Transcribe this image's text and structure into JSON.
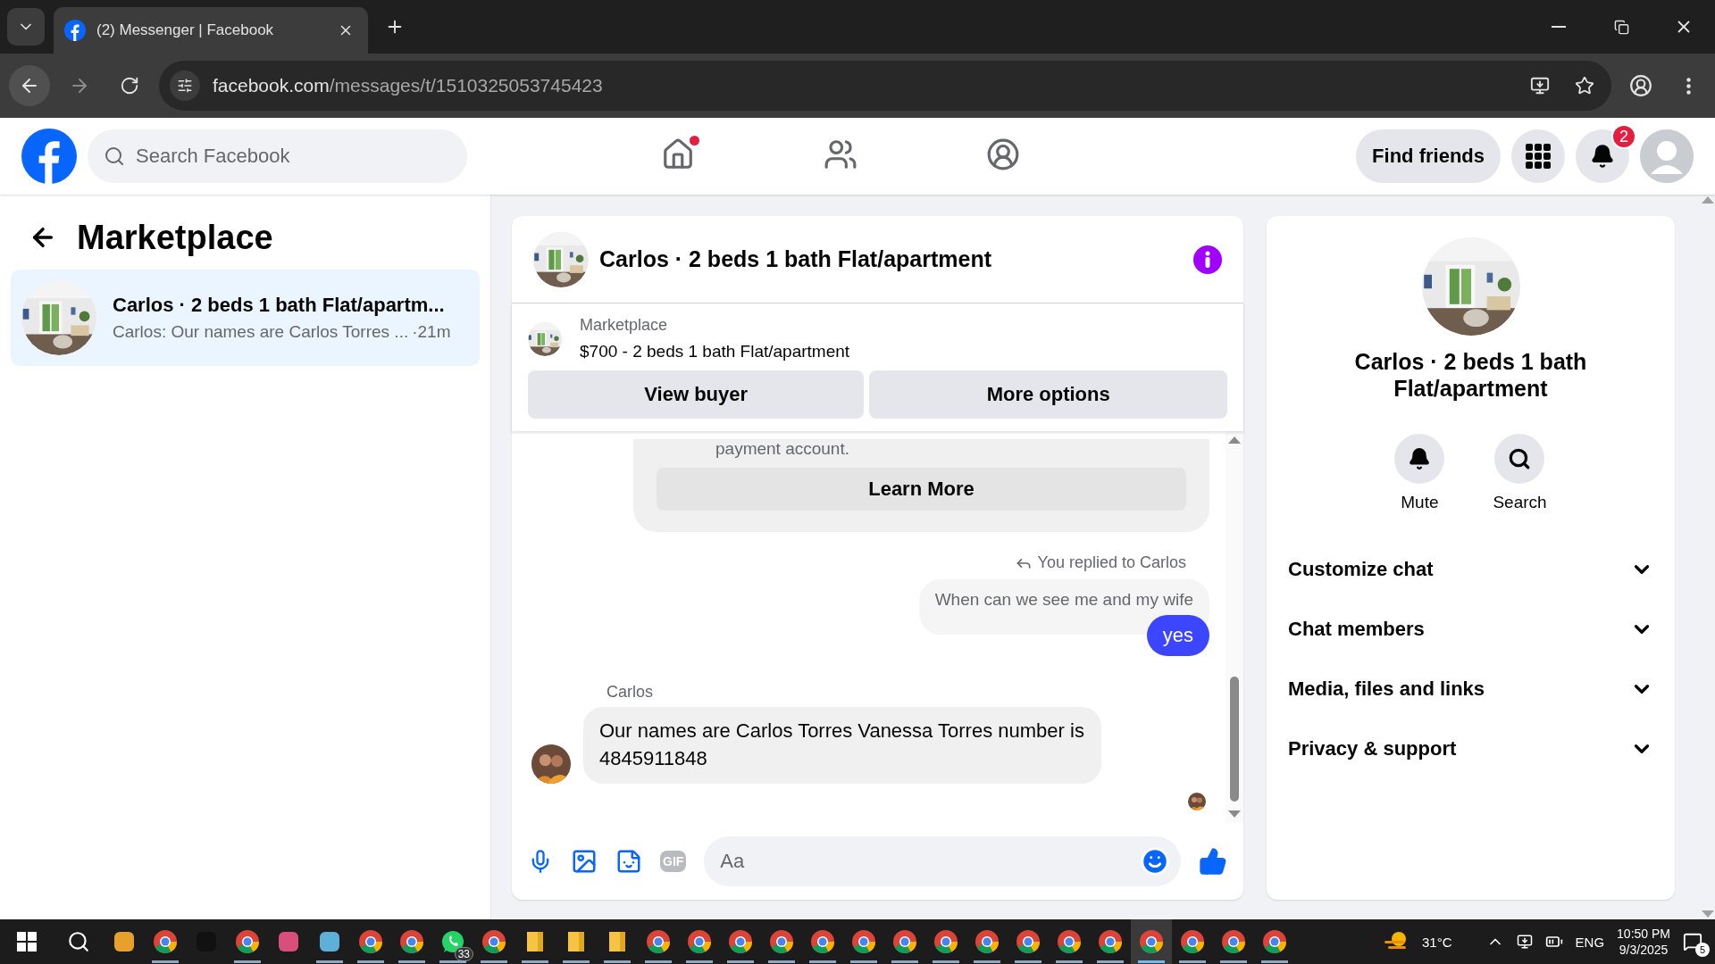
{
  "browser": {
    "tab_title": "(2) Messenger | Facebook",
    "url_host": "facebook.com",
    "url_path": "/messages/t/1510325053745423"
  },
  "header": {
    "search_placeholder": "Search Facebook",
    "nav": [
      {
        "kind": "home",
        "selected": false,
        "dot": true
      },
      {
        "kind": "friends",
        "selected": false,
        "dot": false
      },
      {
        "kind": "groups",
        "selected": false,
        "dot": false
      }
    ],
    "find_friends": "Find friends",
    "notification_count": "2"
  },
  "sidebar": {
    "title": "Marketplace",
    "conversations": [
      {
        "title": "Carlos · 2 beds 1 bath Flat/apartm...",
        "preview": "Carlos: Our names are Carlos Torres ...",
        "time": "·21m",
        "selected": true
      }
    ]
  },
  "chat": {
    "title": "Carlos · 2 beds 1 bath Flat/apartment",
    "listing": {
      "label": "Marketplace",
      "summary": "$700 - 2 beds 1 bath Flat/apartment"
    },
    "buttons": [
      "View buyer",
      "More options"
    ],
    "messages": [
      {
        "kind": "notice",
        "text": "payment account.",
        "button": "Learn More"
      },
      {
        "kind": "reply_note",
        "text": "You replied to Carlos"
      },
      {
        "kind": "quoted",
        "text": "When can we see me and my wife"
      },
      {
        "kind": "outgoing",
        "text": "yes"
      },
      {
        "kind": "sender",
        "text": "Carlos"
      },
      {
        "kind": "incoming",
        "text": "Our names are Carlos  Torres Vanessa Torres number is 4845911848"
      },
      {
        "kind": "seen"
      }
    ],
    "composer": {
      "gif_label": "GIF",
      "placeholder": "Aa"
    }
  },
  "details": {
    "title": "Carlos · 2 beds 1 bath Flat/apartment",
    "actions": [
      {
        "kind": "mute",
        "label": "Mute"
      },
      {
        "kind": "search",
        "label": "Search"
      }
    ],
    "sections": [
      {
        "label": "Customize chat",
        "expanded": false
      },
      {
        "label": "Chat members",
        "expanded": false
      },
      {
        "label": "Media, files and links",
        "expanded": false
      },
      {
        "label": "Privacy & support",
        "expanded": false
      }
    ]
  },
  "taskbar": {
    "apps": [
      {
        "kind": "generic",
        "color": "#e8a02c",
        "running": false,
        "selected": false
      },
      {
        "kind": "chrome",
        "running": true,
        "selected": false
      },
      {
        "kind": "generic",
        "color": "#111111",
        "running": false,
        "selected": false
      },
      {
        "kind": "chrome",
        "running": true,
        "selected": false
      },
      {
        "kind": "generic",
        "color": "#d94f7c",
        "running": false,
        "selected": false
      },
      {
        "kind": "generic",
        "color": "#5fb0d8",
        "running": true,
        "selected": false
      },
      {
        "kind": "chrome",
        "running": true,
        "selected": false
      },
      {
        "kind": "chrome",
        "running": true,
        "selected": false
      },
      {
        "kind": "whatsapp",
        "badge": "33",
        "running": true,
        "selected": false
      },
      {
        "kind": "chrome",
        "running": true,
        "selected": false
      },
      {
        "kind": "folder",
        "running": true,
        "selected": false
      },
      {
        "kind": "folder",
        "running": true,
        "selected": false
      },
      {
        "kind": "folder",
        "running": true,
        "selected": false
      },
      {
        "kind": "chrome",
        "running": true,
        "selected": false
      },
      {
        "kind": "chrome",
        "running": true,
        "selected": false
      },
      {
        "kind": "chrome",
        "running": true,
        "selected": false
      },
      {
        "kind": "chrome",
        "running": true,
        "selected": false
      },
      {
        "kind": "chrome",
        "running": true,
        "selected": false
      },
      {
        "kind": "chrome",
        "running": true,
        "selected": false
      },
      {
        "kind": "chrome",
        "running": true,
        "selected": false
      },
      {
        "kind": "chrome",
        "running": true,
        "selected": false
      },
      {
        "kind": "chrome",
        "running": true,
        "selected": false
      },
      {
        "kind": "chrome",
        "running": true,
        "selected": false
      },
      {
        "kind": "chrome",
        "running": true,
        "selected": false
      },
      {
        "kind": "chrome",
        "running": true,
        "selected": false
      },
      {
        "kind": "chrome",
        "running": true,
        "selected": true
      },
      {
        "kind": "chrome",
        "running": true,
        "selected": false
      },
      {
        "kind": "chrome",
        "running": true,
        "selected": false
      },
      {
        "kind": "chrome",
        "running": true,
        "selected": false
      }
    ],
    "temperature": "31°C",
    "language": "ENG",
    "time": "10:50 PM",
    "date": "9/3/2025",
    "notification_count": "5"
  }
}
